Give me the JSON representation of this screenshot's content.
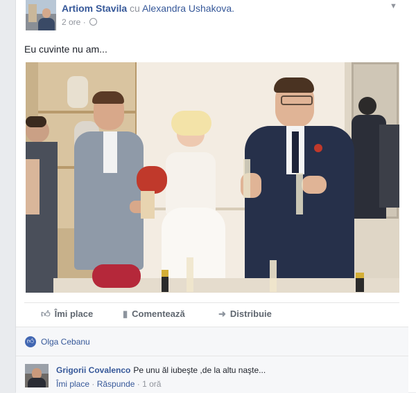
{
  "post": {
    "author": "Artiom Stavila",
    "with_text": "cu",
    "tagged": "Alexandra Ushakova.",
    "time": "2 ore",
    "dot": "·",
    "text": "Eu cuvinte nu am..."
  },
  "actions": {
    "like": "Îmi place",
    "comment": "Comentează",
    "share": "Distribuie"
  },
  "likes": {
    "name": "Olga Cebanu"
  },
  "comment": {
    "author": "Grigorii Covalenco",
    "text": "Pe unu ăl iubeşte ,de la altu naşte...",
    "like": "Îmi place",
    "sep1": "·",
    "reply": "Răspunde",
    "sep2": "·",
    "time": "1 oră"
  },
  "icons": {
    "menu": "chevron-down-icon",
    "privacy": "globe-icon",
    "like": "thumbs-up-icon",
    "comment": "comment-icon",
    "share": "share-arrow-icon",
    "reaction": "like-reaction-icon"
  },
  "colors": {
    "link": "#365899",
    "accent": "#4267b2",
    "muted": "#90949c",
    "text": "#1d2129"
  }
}
